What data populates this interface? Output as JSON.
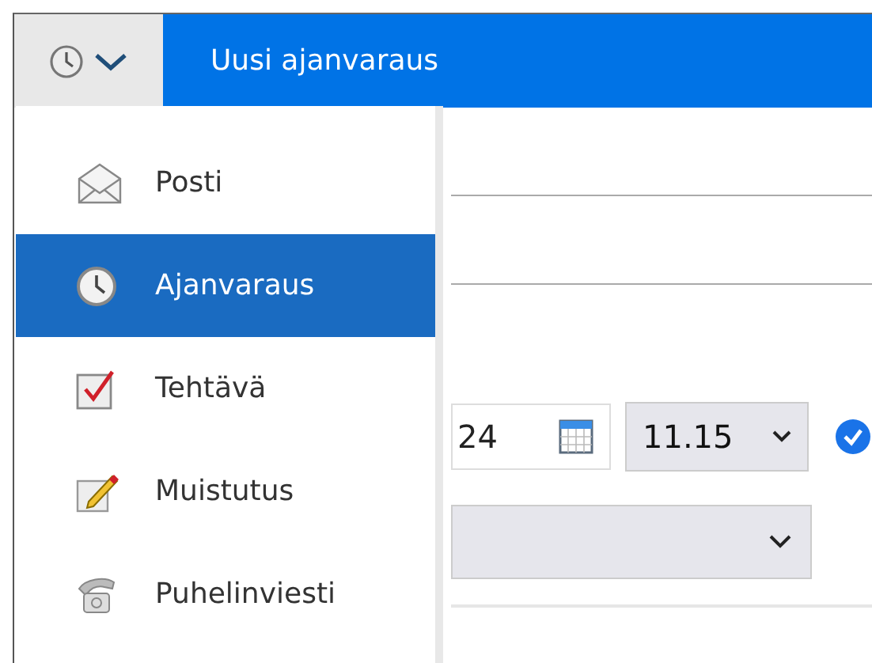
{
  "header": {
    "title": "Uusi ajanvaraus"
  },
  "menu": {
    "items": [
      {
        "label": "Posti",
        "kind": "mail",
        "selected": false
      },
      {
        "label": "Ajanvaraus",
        "kind": "clock",
        "selected": true
      },
      {
        "label": "Tehtävä",
        "kind": "task",
        "selected": false
      },
      {
        "label": "Muistutus",
        "kind": "note",
        "selected": false
      },
      {
        "label": "Puhelinviesti",
        "kind": "phone",
        "selected": false
      }
    ]
  },
  "form": {
    "date": "24",
    "time": "11.15"
  }
}
